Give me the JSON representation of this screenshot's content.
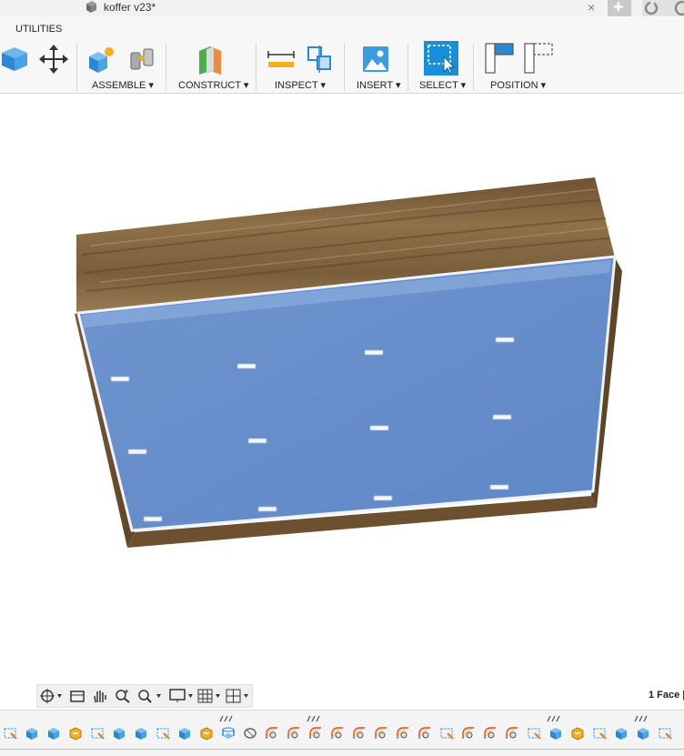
{
  "document": {
    "title": "koffer v23*"
  },
  "tabbar": {
    "close": "×",
    "new_tab": "+"
  },
  "ribbon": {
    "utilities_label": "UTILITIES",
    "groups": [
      {
        "label": "ASSEMBLE ▾"
      },
      {
        "label": "CONSTRUCT ▾"
      },
      {
        "label": "INSPECT ▾"
      },
      {
        "label": "INSERT ▾"
      },
      {
        "label": "SELECT ▾"
      },
      {
        "label": "POSITION ▾"
      }
    ]
  },
  "status": {
    "selection": "1 Face |"
  },
  "colors": {
    "selection_blue": "#6f95cf",
    "select_active": "#1a8fd6",
    "wood": "#7a5c3a"
  },
  "timeline": {
    "icons": [
      "sketch",
      "body",
      "body",
      "parameter",
      "sketch",
      "body",
      "body",
      "sketch",
      "body",
      "parameter",
      "extrude",
      "revolve",
      "fillet",
      "fillet",
      "fillet",
      "fillet",
      "fillet",
      "fillet",
      "fillet",
      "fillet",
      "sketch",
      "fillet",
      "fillet",
      "fillet",
      "sketch",
      "body",
      "parameter",
      "sketch",
      "body",
      "body",
      "sketch"
    ]
  }
}
